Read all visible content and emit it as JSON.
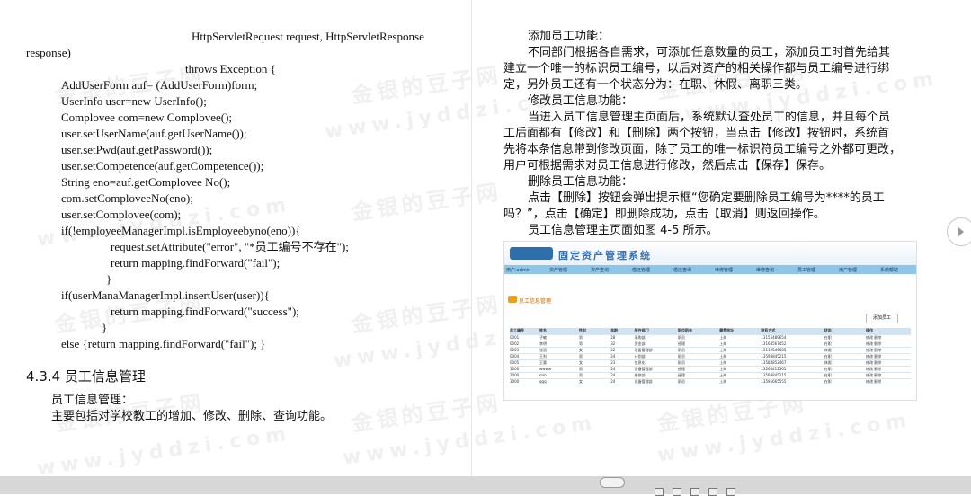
{
  "left_page": {
    "code_lines": [
      "HttpServletRequest request, HttpServletResponse",
      "response)",
      "throws Exception {",
      "AddUserForm auf= (AddUserForm)form;",
      "UserInfo user=new UserInfo();",
      " Complovee com=new Complovee();",
      "user.setUserName(auf.getUserName());",
      " user.setPwd(auf.getPassword());",
      "user.setCompetence(auf.getCompetence());",
      " String eno=auf.getComplovee No();",
      "com.setComploveeNo(eno);",
      "user.setComplovee(com);",
      "if(!employeeManagerImpl.isEmployeebyno(eno)){",
      "request.setAttribute(\"error\", \"*员工编号不存在\");",
      "return mapping.findForward(\"fail\");",
      "}",
      "if(userManaManagerImpl.insertUser(user)){",
      "return mapping.findForward(\"success\");",
      "}",
      "else {return mapping.findForward(\"fail\"); }"
    ],
    "heading": "4.3.4  员工信息管理",
    "para1": "员工信息管理：",
    "para2": "主要包括对学校教工的增加、修改、删除、查询功能。"
  },
  "right_page": {
    "lines": [
      "添加员工功能：",
      "不同部门根据各自需求，可添加任意数量的员工，添加员工时首先给其",
      "建立一个唯一的标识员工编号，以后对资产的相关操作都与员工编号进行绑",
      "定，另外员工还有一个状态分为：在职、休假、离职三类。",
      "修改员工信息功能：",
      "当进入员工信息管理主页面后，系统默认查处员工的信息，并且每个员",
      "工后面都有【修改】和【删除】两个按钮，当点击【修改】按钮时，系统首",
      "先将本条信息带到修改页面，除了员工的唯一标识符员工编号之外都可更改，",
      "用户可根据需求对员工信息进行修改，然后点击【保存】保存。",
      "删除员工信息功能：",
      "点击【删除】按钮会弹出提示框“您确定要删除员工编号为****的员工",
      "吗？”，点击【确定】即删除成功，点击【取消】则返回操作。",
      "员工信息管理主页面如图 4-5 所示。"
    ],
    "figure": {
      "title": "固定资产管理系统",
      "nav": [
        "用户:admin",
        "资产管理",
        "资产查询",
        "借还管理",
        "借还查询",
        "维修管理",
        "维修查询",
        "员工管理",
        "用户管理",
        "系统帮助"
      ],
      "subtitle": "员工信息管理",
      "add_button": "添加员工",
      "header": [
        "员工编号",
        "姓名",
        "性别",
        "年龄",
        "所在部门",
        "职位职务",
        "籍贯地址",
        "联系方式",
        "状态",
        "操作"
      ],
      "rows": [
        [
          "0001",
          "子敏",
          "男",
          "28",
          "采购部",
          "职员",
          "上海",
          "13155489654",
          "在职",
          "修改 删除"
        ],
        [
          "0002",
          "李明",
          "男",
          "32",
          "资金部",
          "经理",
          "上海",
          "13164567452",
          "在职",
          "修改 删除"
        ],
        [
          "0003",
          "张丽",
          "女",
          "22",
          "设备管理部",
          "职员",
          "上海",
          "13112546685",
          "休假",
          "修改 删除"
        ],
        [
          "0004",
          "王利",
          "男",
          "24",
          "计划部",
          "职员",
          "上海",
          "13598845215",
          "在职",
          "修改 删除"
        ],
        [
          "0005",
          "王惠",
          "女",
          "23",
          "信息化",
          "职员",
          "上海",
          "13584852467",
          "休假",
          "修改 删除"
        ],
        [
          "1000",
          "wwww",
          "男",
          "24",
          "设备管理部",
          "经理",
          "上海",
          "13265412365",
          "在职",
          "修改 删除"
        ],
        [
          "2000",
          "mm",
          "男",
          "24",
          "维修部",
          "经理",
          "上海",
          "13598845215",
          "在职",
          "修改 删除"
        ],
        [
          "3000",
          "qqq",
          "女",
          "24",
          "设备管理部",
          "职员",
          "上海",
          "13595665555",
          "在职",
          "修改 删除"
        ]
      ]
    }
  },
  "watermark": {
    "cn": "金银的豆子网",
    "url": "www.jyddzi.com"
  },
  "icons": {
    "next_page": "chevron-right-icon"
  }
}
